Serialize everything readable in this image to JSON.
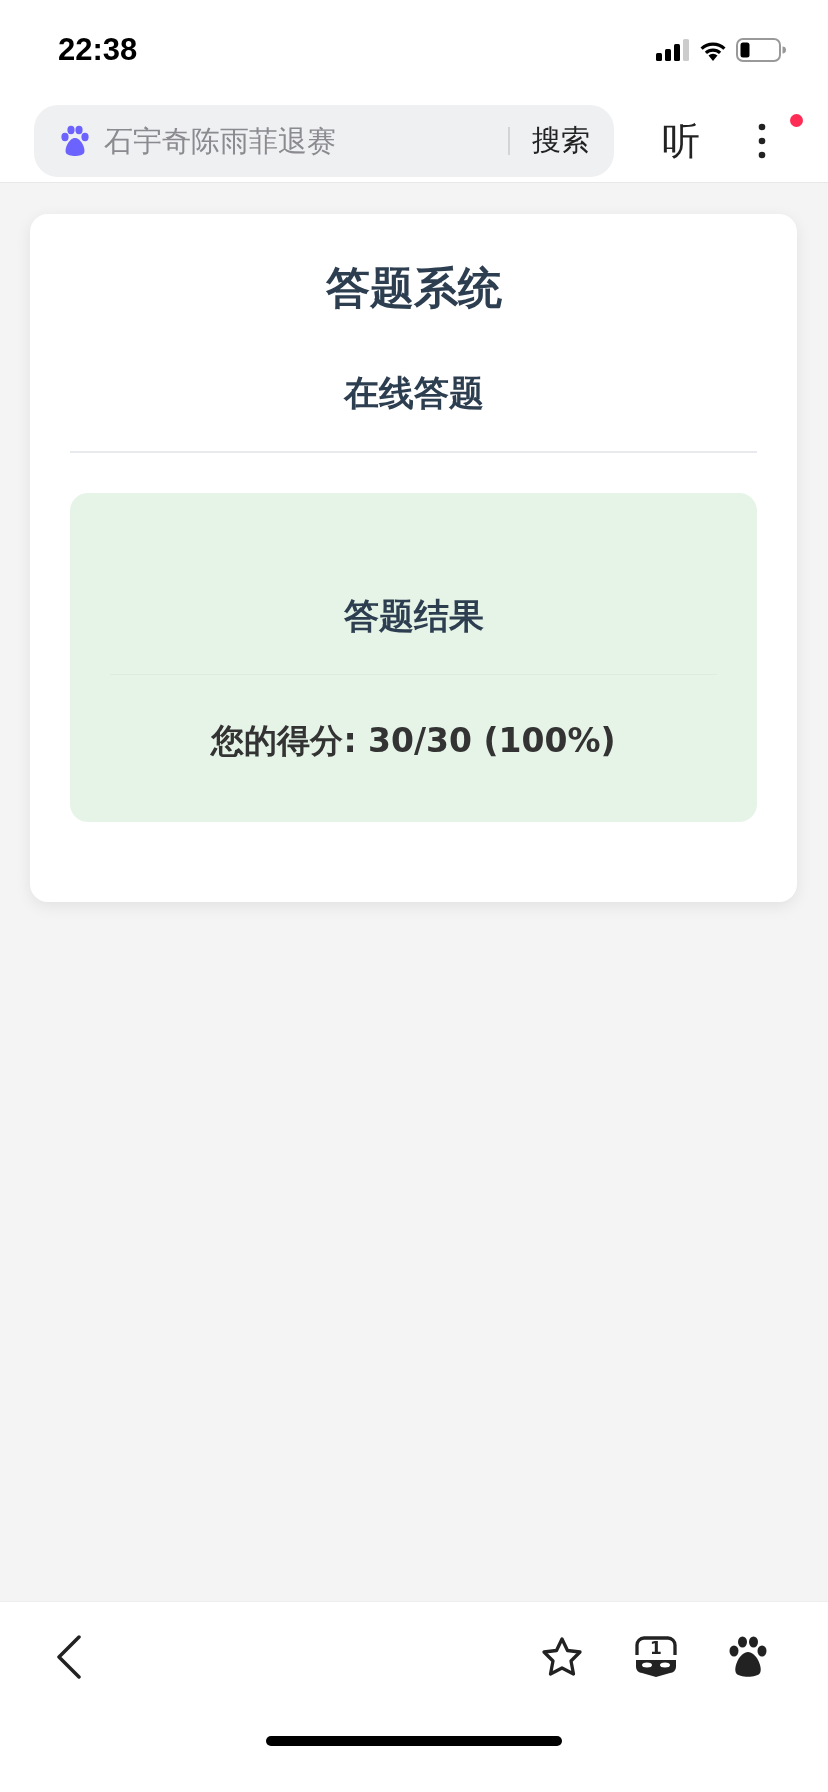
{
  "status_bar": {
    "time": "22:38"
  },
  "browser_bar": {
    "search_placeholder": "石宇奇陈雨菲退赛",
    "search_button": "搜索",
    "listen_button": "听",
    "menu_badge": true
  },
  "card": {
    "title": "答题系统",
    "subtitle": "在线答题",
    "result": {
      "heading": "答题结果",
      "score": "您的得分: 30/30 (100%)"
    }
  },
  "bottom_bar": {
    "tab_count": "1"
  }
}
